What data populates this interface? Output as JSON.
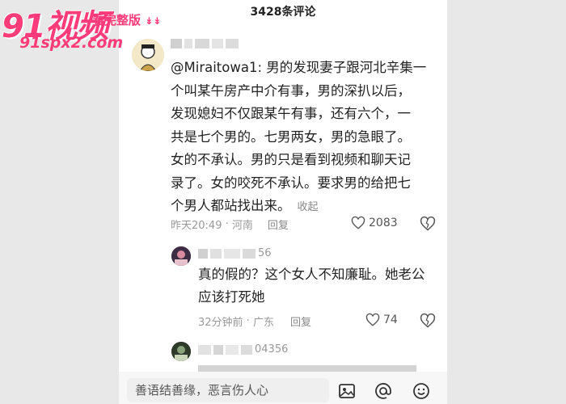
{
  "header": {
    "comment_count_title": "3428条评论"
  },
  "watermark": {
    "logo": "91视频",
    "tag": "看完整版",
    "url": "91spx2.com"
  },
  "comment1": {
    "text_lines": [
      "@Miraitowa1: 男的发现妻子跟河北辛集一",
      "个叫某午房产中介有事，男的深扒以后，",
      "发现媳妇不仅跟某午有事，还有六个，一",
      "共是七个男的。七男两女，男的急眼了。",
      "女的不承认。男的只是看到视频和聊天记",
      "录了。女的咬死不承认。要求男的给把七",
      "个男人都站找出来。"
    ],
    "collapse": "收起",
    "time": "昨天20:49",
    "location": "河南",
    "reply": "回复",
    "likes": "2083"
  },
  "reply1": {
    "name_suffix": "56",
    "text_lines": [
      "真的假的？这个女人不知廉耻。她老公",
      "应该打死她"
    ],
    "time": "32分钟前",
    "location": "广东",
    "reply": "回复",
    "likes": "74"
  },
  "reply2": {
    "name_suffix": "04356"
  },
  "input": {
    "placeholder": "善语结善缘，恶言伤人心"
  },
  "colors": {
    "accent": "#ff3b7a"
  }
}
